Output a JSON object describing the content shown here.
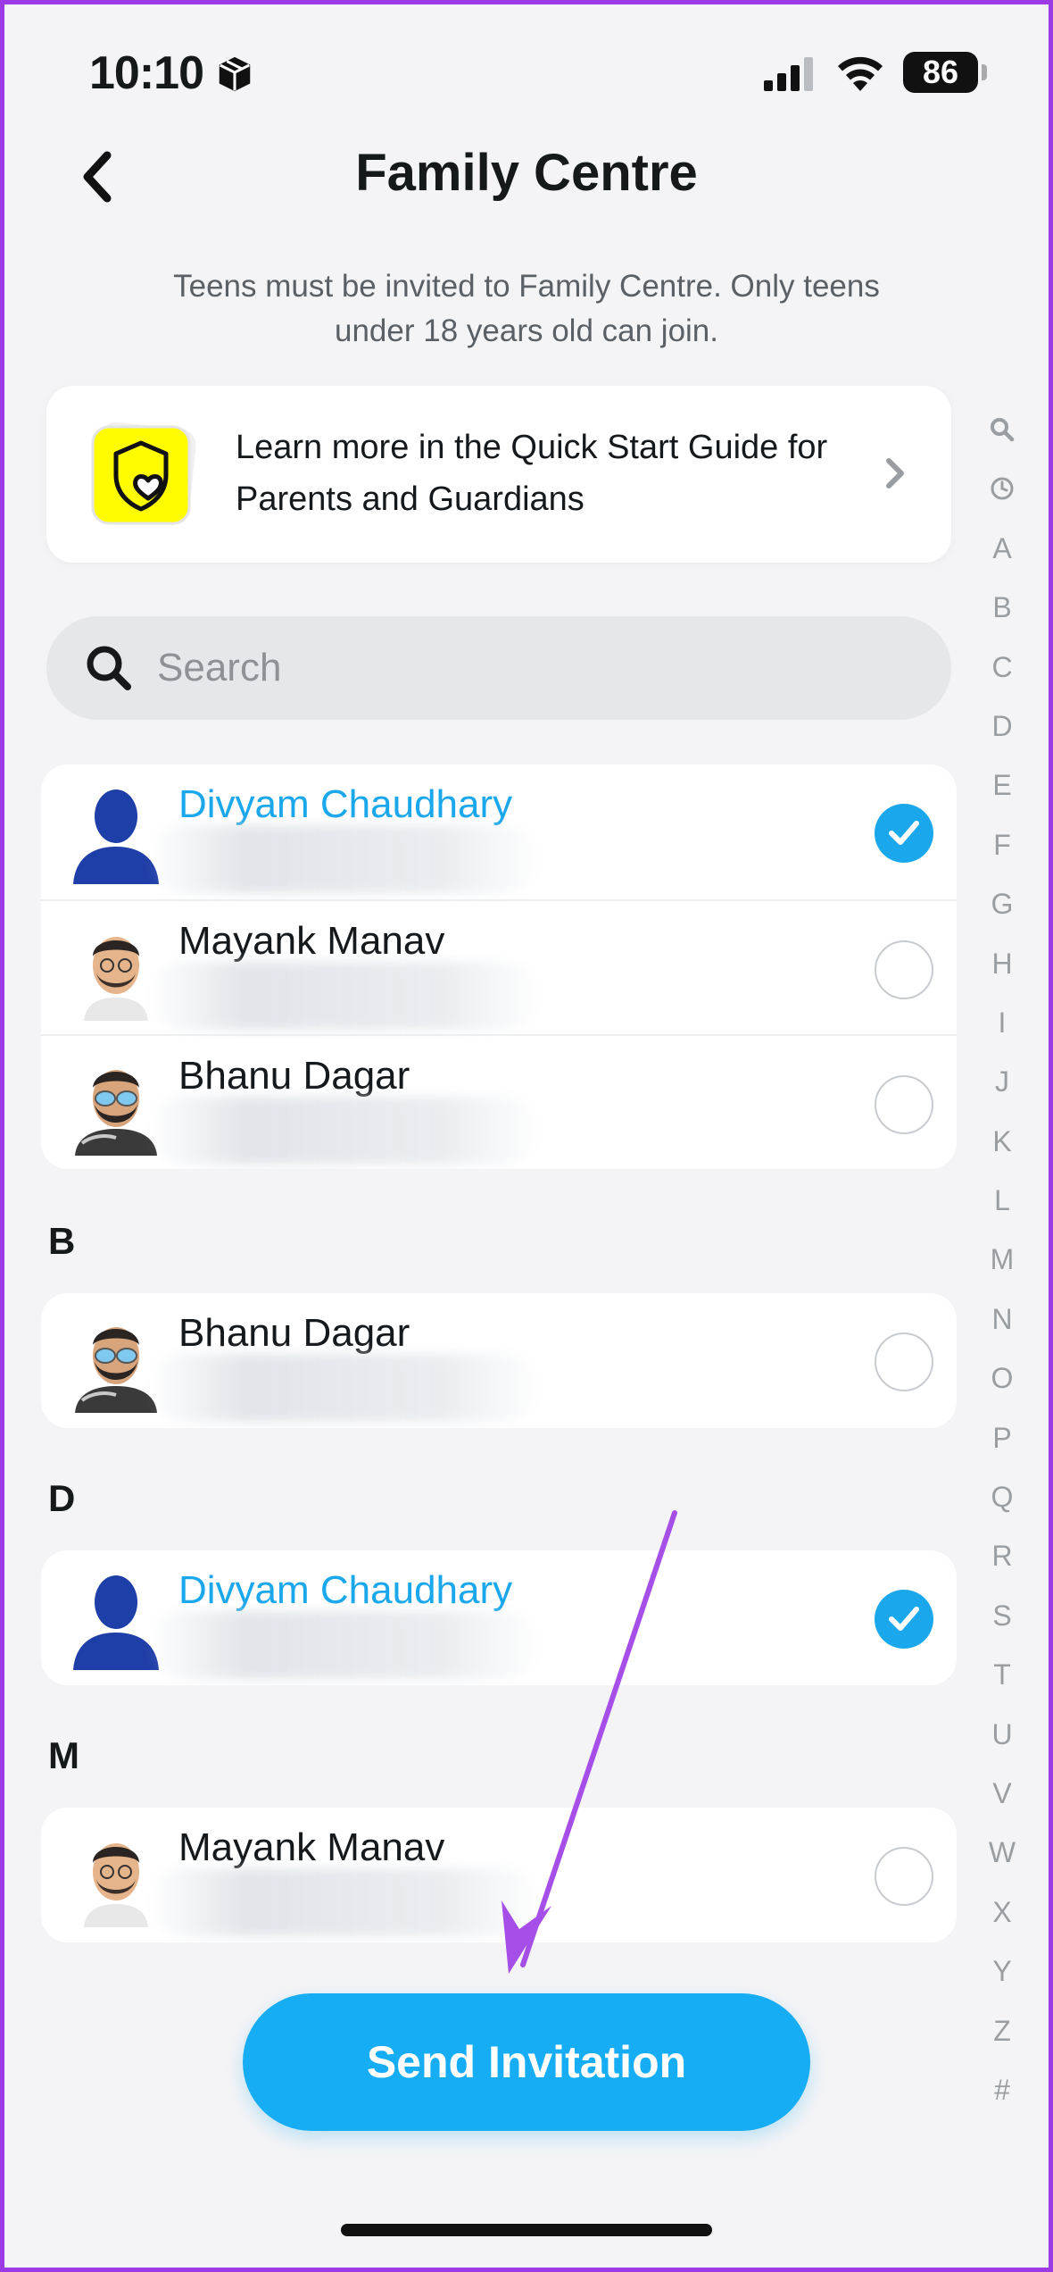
{
  "status_bar": {
    "time": "10:10",
    "battery": "86"
  },
  "header": {
    "title": "Family Centre"
  },
  "subtitle": "Teens must be invited to Family Centre. Only teens under 18 years old can join.",
  "guide_card": {
    "text": "Learn more in the Quick Start Guide for Parents and Guardians"
  },
  "search": {
    "placeholder": "Search"
  },
  "suggested": [
    {
      "name": "Divyam Chaudhary",
      "selected": true
    },
    {
      "name": "Mayank Manav",
      "selected": false
    },
    {
      "name": "Bhanu Dagar",
      "selected": false
    }
  ],
  "sections": [
    {
      "letter": "B",
      "contacts": [
        {
          "name": "Bhanu Dagar",
          "selected": false
        }
      ]
    },
    {
      "letter": "D",
      "contacts": [
        {
          "name": "Divyam Chaudhary",
          "selected": true
        }
      ]
    },
    {
      "letter": "M",
      "contacts": [
        {
          "name": "Mayank Manav",
          "selected": false
        }
      ]
    }
  ],
  "index_letters": [
    "A",
    "B",
    "C",
    "D",
    "E",
    "F",
    "G",
    "H",
    "I",
    "J",
    "K",
    "L",
    "M",
    "N",
    "O",
    "P",
    "Q",
    "R",
    "S",
    "T",
    "U",
    "V",
    "W",
    "X",
    "Y",
    "Z",
    "#"
  ],
  "send_button": {
    "label": "Send Invitation"
  },
  "colors": {
    "accent": "#16adf4",
    "selected_text": "#1aa7ec",
    "annotation_arrow": "#a64ee8"
  }
}
